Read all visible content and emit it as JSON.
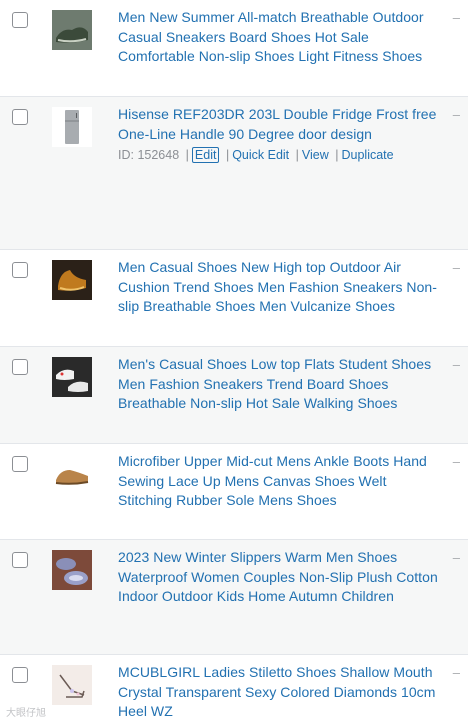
{
  "colors": {
    "link": "#2271b1",
    "muted": "#8c8f94",
    "stripe": "#f6f7f7",
    "border": "#e3e6ea"
  },
  "rows": [
    {
      "title": "Men New Summer All-match Breathable Outdoor Casual Sneakers Board Shoes Hot Sale Comfortable Non-slip Shoes Light Fitness Shoes",
      "thumb": "green-sneaker-image",
      "dash": "–"
    },
    {
      "title": "Hisense REF203DR 203L Double Fridge Frost free One-Line Handle 90 Degree door design",
      "thumb": "fridge-image",
      "dash": "–",
      "actions": {
        "id_label": "ID: 152648",
        "sep": "|",
        "edit": "Edit",
        "quick_edit": "Quick Edit",
        "view": "View",
        "duplicate": "Duplicate"
      }
    },
    {
      "title": "Men Casual Shoes New High top Outdoor Air Cushion Trend Shoes Men Fashion Sneakers Non-slip Breathable Shoes Men Vulcanize Shoes",
      "thumb": "brown-high-top-image",
      "dash": "–"
    },
    {
      "title": "Men's Casual Shoes Low top Flats Student Shoes Men Fashion Sneakers Trend Board Shoes Breathable Non-slip Hot Sale Walking Shoes",
      "thumb": "white-sneakers-image",
      "dash": "–"
    },
    {
      "title": "Microfiber Upper Mid-cut Mens Ankle Boots Hand Sewing Lace Up Mens Canvas Shoes Welt Stitching Rubber Sole Mens Shoes",
      "thumb": "tan-boot-image",
      "dash": "–"
    },
    {
      "title": "2023 New Winter Slippers Warm Men Shoes Waterproof Women Couples Non-Slip Plush Cotton Indoor Outdoor Kids Home Autumn Children",
      "thumb": "plush-slippers-image",
      "dash": "–"
    },
    {
      "title": "MCUBLGIRL Ladies Stiletto Shoes Shallow Mouth Crystal Transparent Sexy Colored Diamonds 10cm Heel WZ",
      "thumb": "stiletto-image",
      "dash": "–"
    }
  ],
  "watermark": "大眼仔旭"
}
